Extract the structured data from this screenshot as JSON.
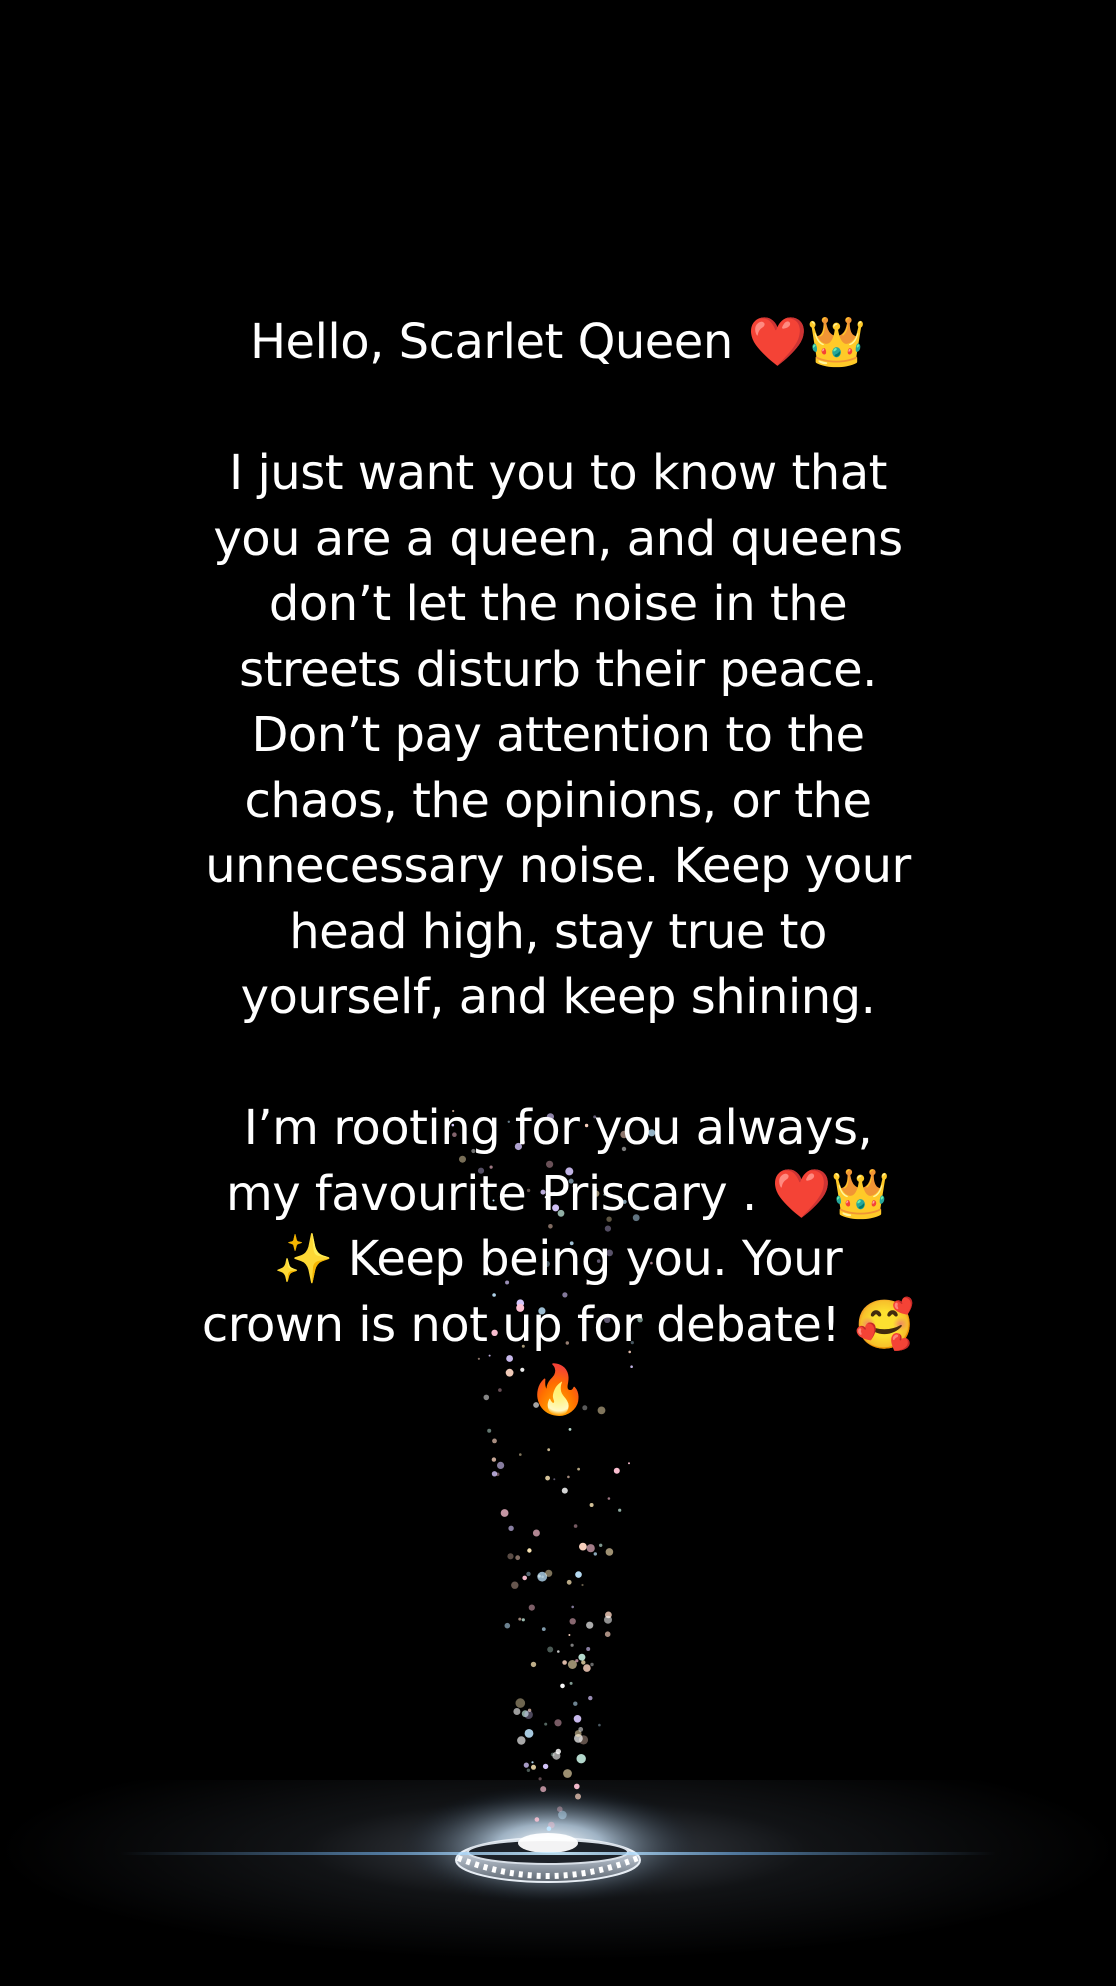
{
  "message": {
    "greeting": "Hello, Scarlet Queen ❤️👑",
    "body": "I just want you to know that you are a queen, and queens don’t let the noise in the streets disturb their peace. Don’t pay attention to the chaos, the opinions, or the unnecessary noise. Keep your head high, stay true to yourself, and keep shining.",
    "closing": "I’m rooting for you always, my favourite Priscary . ❤️👑✨ Keep being you. Your crown is not up for debate! 🥰🔥"
  },
  "scene": {
    "background_color": "#000000",
    "text_color": "#ffffff",
    "object": "diamond-ring",
    "effect": "sparkles"
  }
}
